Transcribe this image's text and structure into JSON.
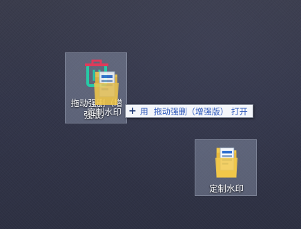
{
  "desktop": {
    "icons": [
      {
        "label": "拖动强删（增强版）",
        "icon": "trash-can-icon",
        "state": "selected-drop-target"
      },
      {
        "label": "定制水印",
        "icon": "folder-icon",
        "state": "selected"
      }
    ],
    "drag": {
      "item_label": "定制水印",
      "item_icon": "folder-icon"
    },
    "tooltip": {
      "icon": "plus-icon",
      "verb": "用",
      "target": "拖动强删（增强版）",
      "action": "打开"
    },
    "colors": {
      "tooltip_text": "#2a55b8",
      "trash_red": "#e03a5a",
      "trash_green": "#27c9a6",
      "folder_yellow": "#f2c94c"
    }
  }
}
